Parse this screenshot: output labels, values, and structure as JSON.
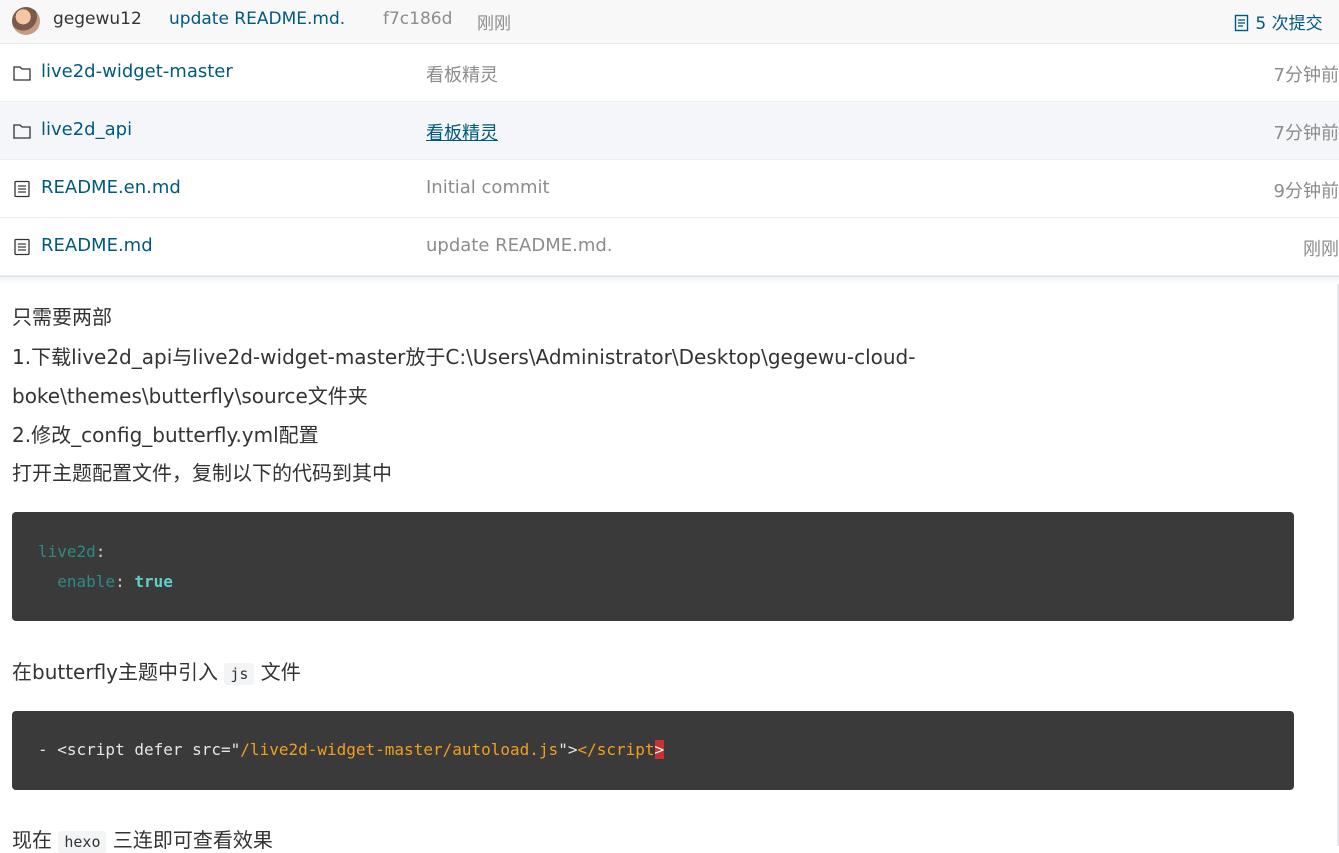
{
  "commit": {
    "user": "gegewu12",
    "message": "update README.md.",
    "hash": "f7c186d",
    "time": "刚刚",
    "count_label": "5 次提交"
  },
  "files": [
    {
      "name": "live2d-widget-master",
      "type": "folder",
      "message": "看板精灵",
      "time": "7分钟前"
    },
    {
      "name": "live2d_api",
      "type": "folder",
      "message": "看板精灵",
      "time": "7分钟前"
    },
    {
      "name": "README.en.md",
      "type": "file",
      "message": "Initial commit",
      "time": "9分钟前"
    },
    {
      "name": "README.md",
      "type": "file",
      "message": "update README.md.",
      "time": "刚刚"
    }
  ],
  "readme": {
    "line1": "只需要两部",
    "line2": "1.下载live2d_api与live2d-widget-master放于C:\\Users\\Administrator\\Desktop\\gegewu-cloud-",
    "line3": "boke\\themes\\butterfly\\source文件夹",
    "line4": "2.修改_config_butterfly.yml配置",
    "line5": "打开主题配置文件，复制以下的代码到其中",
    "code1": {
      "key1": "live2d",
      "colon1": ":",
      "key2": "enable",
      "colon2": ": ",
      "value2": "true"
    },
    "line6_prefix": "在butterfly主题中引入",
    "line6_code": "js",
    "line6_suffix": "文件",
    "code2": {
      "dash": "- ",
      "open": "<script defer src=\"",
      "src": "/live2d-widget-master/autoload.js",
      "close_quote": "\">",
      "close_tag": "</script",
      "cursor": ">"
    },
    "line7_prefix": "现在",
    "line7_code": "hexo",
    "line7_suffix": "三连即可查看效果"
  },
  "colors": {
    "link": "#005980",
    "code_bg": "#3a3a3a",
    "string": "#f0a020",
    "key": "#2e8b85"
  }
}
